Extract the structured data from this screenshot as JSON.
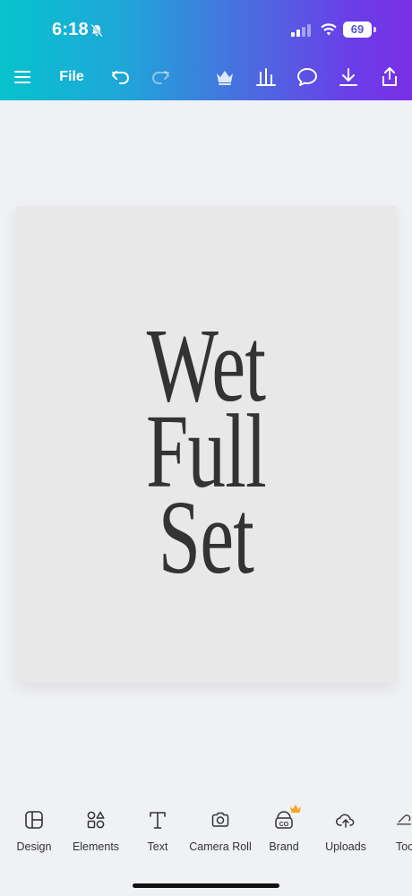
{
  "status_bar": {
    "time": "6:18",
    "battery": "69"
  },
  "toolbar": {
    "menu_icon": "hamburger-menu-icon",
    "file_label": "File",
    "undo_icon": "undo-icon",
    "redo_icon": "redo-icon",
    "crown_icon": "crown-icon",
    "insights_icon": "bar-chart-icon",
    "comment_icon": "comment-icon",
    "download_icon": "download-icon",
    "share_icon": "share-icon"
  },
  "design": {
    "lines": [
      "Wet",
      "Full",
      "Set"
    ]
  },
  "bottom_tabs": [
    {
      "label": "Design",
      "icon": "layout-icon"
    },
    {
      "label": "Elements",
      "icon": "shapes-icon"
    },
    {
      "label": "Text",
      "icon": "text-icon"
    },
    {
      "label": "Camera Roll",
      "icon": "camera-icon"
    },
    {
      "label": "Brand",
      "icon": "brand-icon"
    },
    {
      "label": "Uploads",
      "icon": "cloud-upload-icon"
    },
    {
      "label": "Too",
      "icon": "tools-icon"
    }
  ],
  "colors": {
    "gradient_start": "#07c3cc",
    "gradient_end": "#7b2fe6",
    "page_background": "#e8e8e9",
    "text": "#333333",
    "crown_badge": "#f5a623"
  }
}
